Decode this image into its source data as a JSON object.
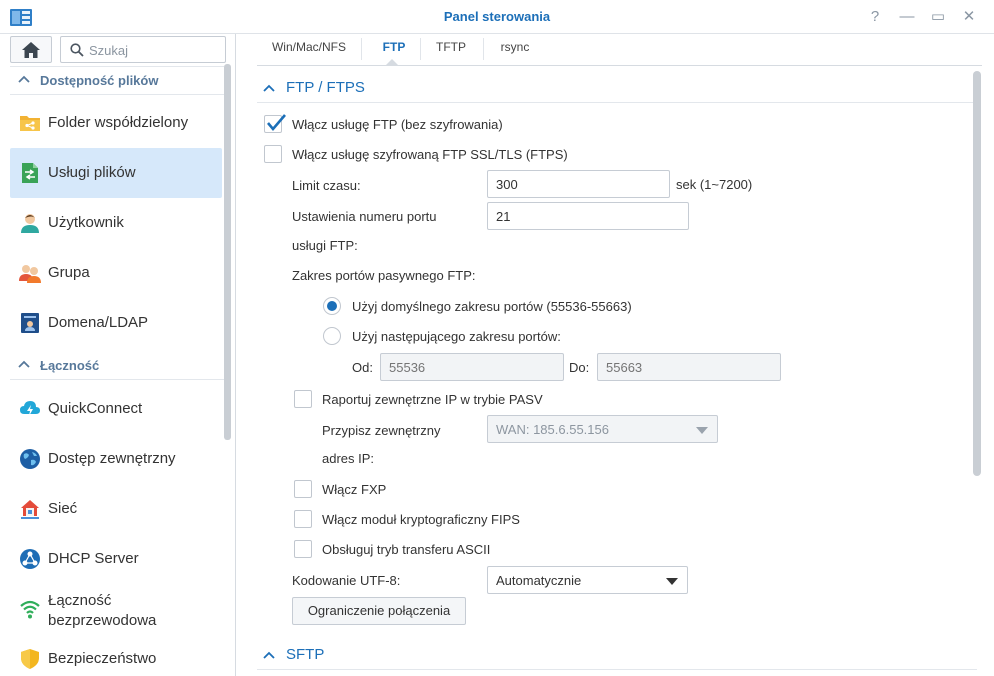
{
  "window": {
    "title": "Panel sterowania",
    "controls": {
      "help": "?",
      "minimize": "—",
      "maximize": "▭",
      "close": "✕"
    }
  },
  "sidebar": {
    "search_placeholder": "Szukaj",
    "groups": [
      {
        "label": "Dostępność plików",
        "items": [
          {
            "label": "Folder współdzielony",
            "icon": "shared-folder-icon"
          },
          {
            "label": "Usługi plików",
            "icon": "file-services-icon",
            "active": true
          },
          {
            "label": "Użytkownik",
            "icon": "user-icon"
          },
          {
            "label": "Grupa",
            "icon": "group-icon"
          },
          {
            "label": "Domena/LDAP",
            "icon": "domain-ldap-icon"
          }
        ]
      },
      {
        "label": "Łączność",
        "items": [
          {
            "label": "QuickConnect",
            "icon": "quickconnect-icon"
          },
          {
            "label": "Dostęp zewnętrzny",
            "icon": "external-access-icon"
          },
          {
            "label": "Sieć",
            "icon": "network-icon"
          },
          {
            "label": "DHCP Server",
            "icon": "dhcp-server-icon"
          },
          {
            "label": "Łączność bezprzewodowa",
            "line1": "Łączność",
            "line2": "bezprzewodowa",
            "icon": "wireless-icon"
          },
          {
            "label": "Bezpieczeństwo",
            "icon": "security-icon"
          }
        ]
      }
    ]
  },
  "tabs": [
    {
      "label": "Win/Mac/NFS"
    },
    {
      "label": "FTP",
      "active": true
    },
    {
      "label": "TFTP"
    },
    {
      "label": "rsync"
    }
  ],
  "ftp": {
    "section_title": "FTP / FTPS",
    "enable_ftp": {
      "label": "Włącz usługę FTP (bez szyfrowania)",
      "checked": true
    },
    "enable_ftps": {
      "label": "Włącz usługę szyfrowaną FTP SSL/TLS (FTPS)",
      "checked": false
    },
    "timeout": {
      "label": "Limit czasu:",
      "value": "300",
      "hint": "sek (1~7200)"
    },
    "port": {
      "label_line1": "Ustawienia numeru portu",
      "label_line2": "usługi FTP:",
      "value": "21"
    },
    "passive_range_label": "Zakres portów pasywnego FTP:",
    "use_default_range": {
      "label": "Użyj domyślnego zakresu portów (55536-55663)",
      "selected": true
    },
    "use_custom_range": {
      "label": "Użyj następującego zakresu portów:",
      "selected": false
    },
    "from": {
      "label": "Od:",
      "placeholder": "55536"
    },
    "to": {
      "label": "Do:",
      "placeholder": "55663"
    },
    "report_external_ip": {
      "label": "Raportuj zewnętrzne IP w trybie PASV",
      "checked": false
    },
    "assign_external": {
      "label_line1": "Przypisz zewnętrzny",
      "label_line2": "adres IP:",
      "value": "WAN: 185.6.55.156"
    },
    "enable_fxp": {
      "label": "Włącz FXP",
      "checked": false
    },
    "enable_fips": {
      "label": "Włącz moduł kryptograficzny FIPS",
      "checked": false
    },
    "ascii_mode": {
      "label": "Obsługuj tryb transferu ASCII",
      "checked": false
    },
    "utf8": {
      "label": "Kodowanie UTF-8:",
      "value": "Automatycznie"
    },
    "connection_limit_button": "Ograniczenie połączenia"
  },
  "sftp": {
    "section_title": "SFTP"
  },
  "colors": {
    "accent": "#1c6fb8",
    "active_item_bg": "#d6e8fa",
    "group_header": "#57789a"
  }
}
